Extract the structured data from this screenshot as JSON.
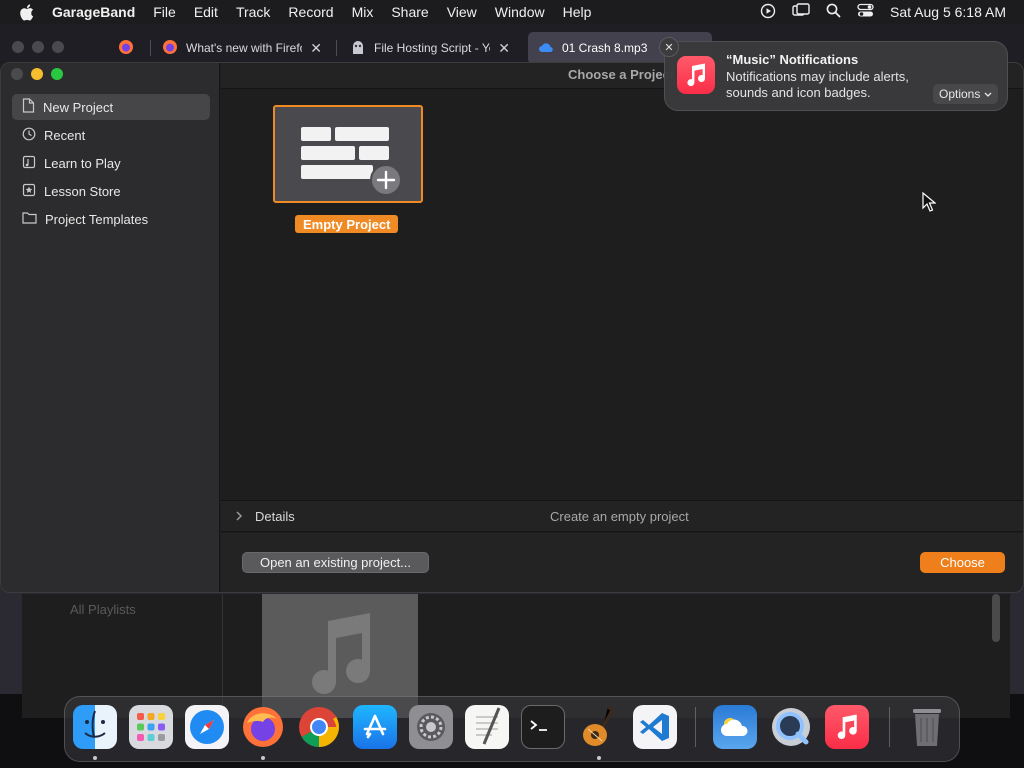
{
  "menubar": {
    "app_name": "GarageBand",
    "items": [
      "File",
      "Edit",
      "Track",
      "Record",
      "Mix",
      "Share",
      "View",
      "Window",
      "Help"
    ],
    "clock": "Sat Aug 5  6:18 AM",
    "status_icons": [
      "screen-record-icon",
      "screen-mirroring-icon",
      "spotlight-icon",
      "control-center-icon"
    ]
  },
  "browser": {
    "tabs": [
      {
        "title": "What's new with Firefox",
        "icon": "firefox-icon"
      },
      {
        "title": "File Hosting Script - Yeti",
        "icon": "yeti-icon"
      },
      {
        "title": "01 Crash 8.mp3",
        "icon": "cloud-icon",
        "active": true
      }
    ]
  },
  "music_app": {
    "sidebar_label": "All Playlists"
  },
  "garageband": {
    "window_title": "Choose a Project",
    "sidebar": [
      {
        "label": "New Project",
        "icon": "document-icon",
        "selected": true
      },
      {
        "label": "Recent",
        "icon": "clock-icon"
      },
      {
        "label": "Learn to Play",
        "icon": "music-stand-icon"
      },
      {
        "label": "Lesson Store",
        "icon": "star-icon"
      },
      {
        "label": "Project Templates",
        "icon": "folder-icon"
      }
    ],
    "template": {
      "label": "Empty Project"
    },
    "details": {
      "label": "Details",
      "description": "Create an empty project"
    },
    "buttons": {
      "open_existing": "Open an existing project...",
      "choose": "Choose"
    }
  },
  "notification": {
    "title": "“Music” Notifications",
    "body": "Notifications may include alerts, sounds and icon badges.",
    "options_label": "Options"
  },
  "dock": {
    "apps": [
      "Finder",
      "Launchpad",
      "Safari",
      "Firefox",
      "Chrome",
      "App Store",
      "System Settings",
      "TextEdit",
      "Terminal",
      "GarageBand",
      "Visual Studio Code",
      "Weather",
      "QuickTime Player",
      "Music",
      "Trash"
    ]
  },
  "colors": {
    "accent_orange": "#ee7f1a",
    "selection_gray": "#464649"
  }
}
